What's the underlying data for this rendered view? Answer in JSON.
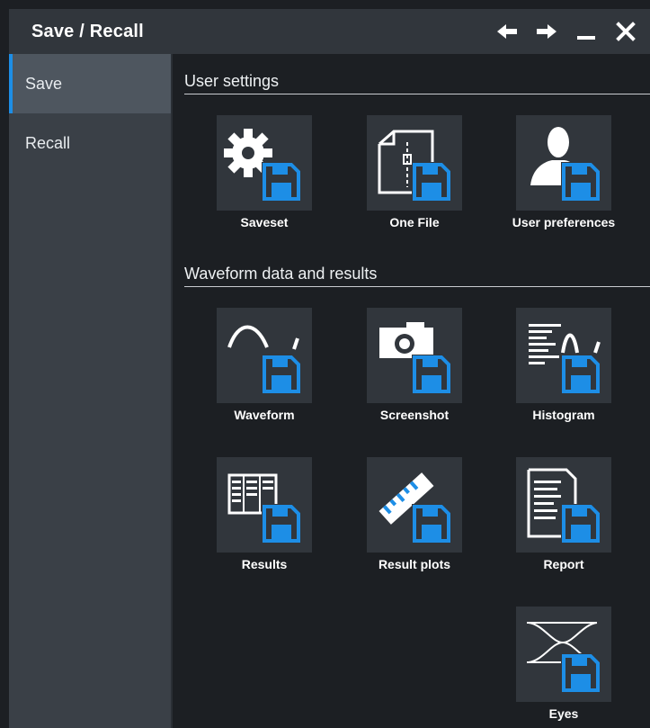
{
  "window": {
    "title": "Save / Recall"
  },
  "titlebar_icons": [
    "back-arrow-icon",
    "forward-arrow-icon",
    "minimize-icon",
    "close-icon"
  ],
  "sidebar": {
    "items": [
      {
        "label": "Save",
        "active": true
      },
      {
        "label": "Recall",
        "active": false
      }
    ]
  },
  "sections": {
    "user_settings": {
      "title": "User settings",
      "tiles": [
        {
          "label": "Saveset",
          "icon": "gear-save-icon"
        },
        {
          "label": "One File",
          "icon": "file-save-icon"
        },
        {
          "label": "User preferences",
          "icon": "user-save-icon"
        }
      ]
    },
    "waveform": {
      "title": "Waveform data and results",
      "tiles": [
        {
          "label": "Waveform",
          "icon": "waveform-save-icon"
        },
        {
          "label": "Screenshot",
          "icon": "camera-save-icon"
        },
        {
          "label": "Histogram",
          "icon": "histogram-save-icon"
        },
        {
          "label": "Results",
          "icon": "results-table-save-icon"
        },
        {
          "label": "Result plots",
          "icon": "ruler-save-icon"
        },
        {
          "label": "Report",
          "icon": "report-save-icon"
        },
        {
          "label": "Eyes",
          "icon": "eye-diagram-save-icon"
        }
      ]
    }
  },
  "colors": {
    "accent": "#1d8ee6",
    "background": "#1c1f23",
    "sidebar": "#3a4047",
    "tile": "#31363c"
  }
}
